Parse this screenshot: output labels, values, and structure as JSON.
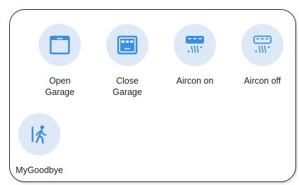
{
  "accent_color": "#3b8fe0",
  "icon_bg_color": "#dde9f7",
  "shortcuts": [
    {
      "label": "Open\nGarage",
      "icon": "open-garage-icon"
    },
    {
      "label": "Close\nGarage",
      "icon": "close-garage-icon"
    },
    {
      "label": "Aircon on",
      "icon": "aircon-on-icon"
    },
    {
      "label": "Aircon off",
      "icon": "aircon-off-icon"
    },
    {
      "label": "MyGoodbye",
      "icon": "walking-person-icon"
    }
  ]
}
